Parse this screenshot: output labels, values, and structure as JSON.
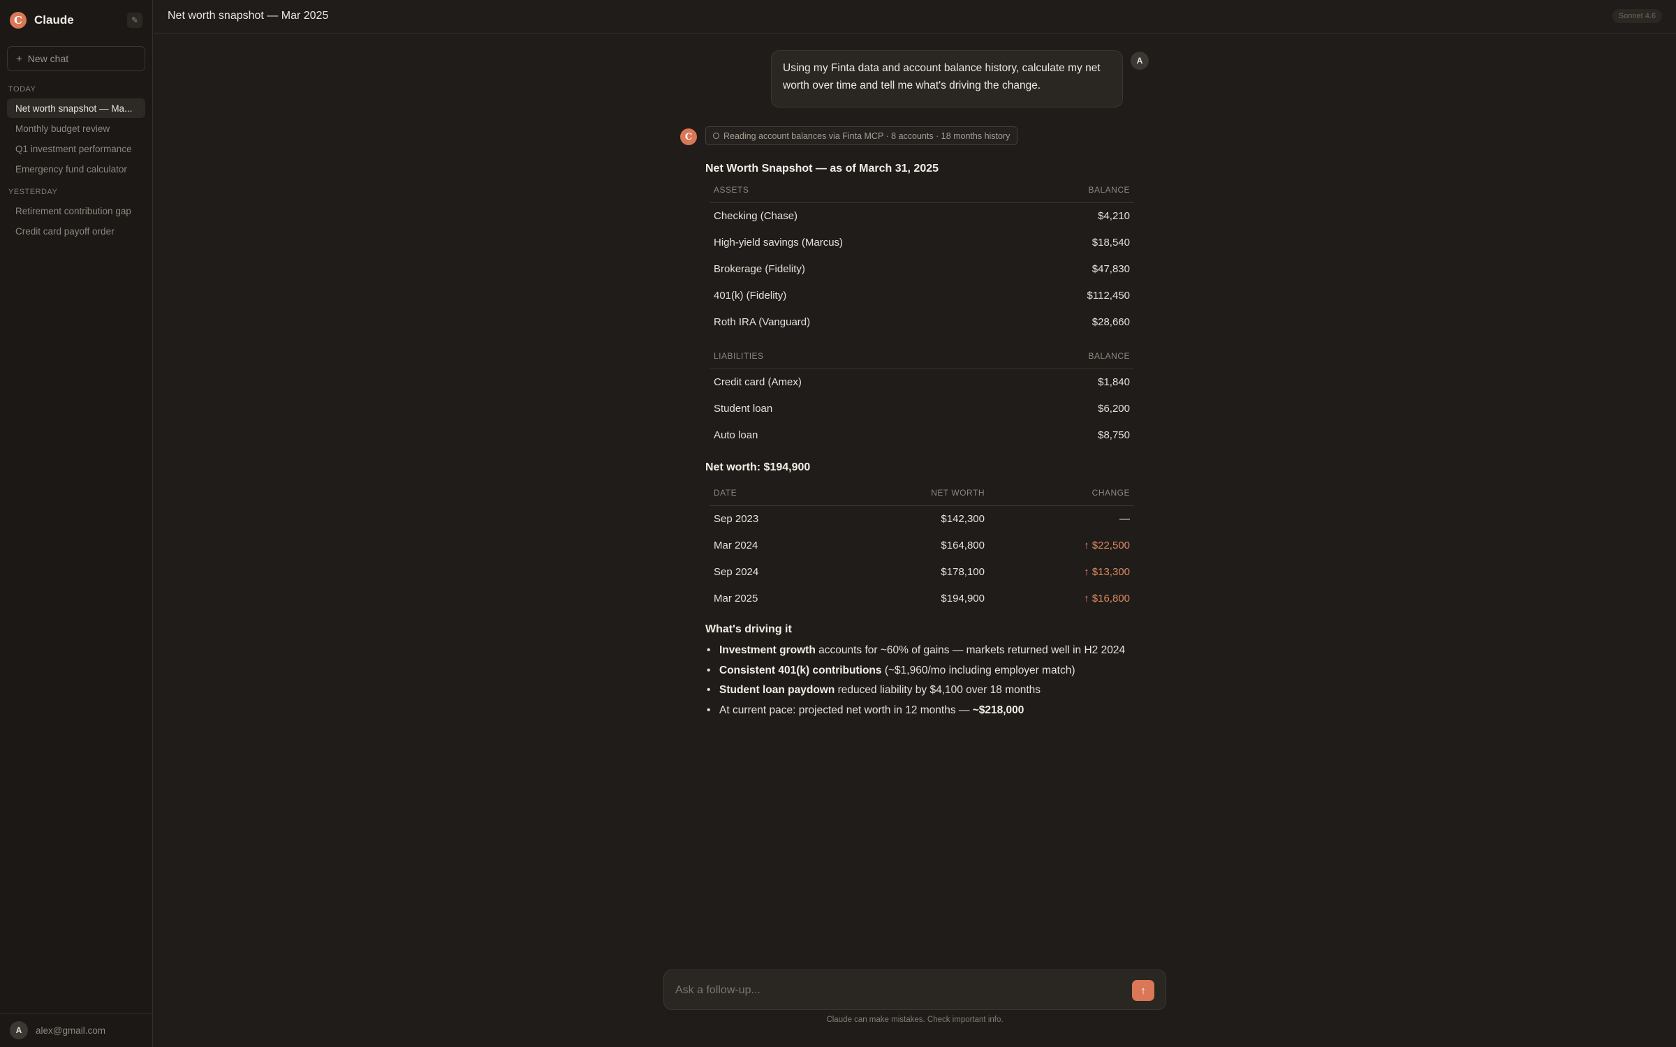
{
  "sidebar": {
    "brand": "Claude",
    "logo_letter": "C",
    "edit_icon": "✎",
    "new_chat_plus": "+",
    "new_chat_label": "New chat",
    "section_today": "TODAY",
    "section_yesterday": "YESTERDAY",
    "today_items": [
      {
        "label": "Net worth snapshot — Ma..."
      },
      {
        "label": "Monthly budget review"
      },
      {
        "label": "Q1 investment performance"
      },
      {
        "label": "Emergency fund calculator"
      }
    ],
    "yesterday_items": [
      {
        "label": "Retirement contribution gap"
      },
      {
        "label": "Credit card payoff order"
      }
    ],
    "user_initial": "A",
    "user_email": "alex@gmail.com"
  },
  "header": {
    "title": "Net worth snapshot — Mar 2025",
    "model": "Sonnet 4.6"
  },
  "user_message": {
    "avatar": "A",
    "text": "Using my Finta data and account balance history, calculate my net worth over time and tell me what's driving the change."
  },
  "assistant": {
    "icon_letter": "C",
    "tool_status": "Reading account balances via Finta MCP · 8 accounts · 18 months history",
    "snapshot_title": "Net Worth Snapshot — as of March 31, 2025",
    "assets_header": "ASSETS",
    "balance_header": "BALANCE",
    "assets": [
      {
        "name": "Checking (Chase)",
        "balance": "$4,210"
      },
      {
        "name": "High-yield savings (Marcus)",
        "balance": "$18,540"
      },
      {
        "name": "Brokerage (Fidelity)",
        "balance": "$47,830"
      },
      {
        "name": "401(k) (Fidelity)",
        "balance": "$112,450"
      },
      {
        "name": "Roth IRA (Vanguard)",
        "balance": "$28,660"
      }
    ],
    "liabilities_header": "LIABILITIES",
    "liabilities": [
      {
        "name": "Credit card (Amex)",
        "balance": "$1,840"
      },
      {
        "name": "Student loan",
        "balance": "$6,200"
      },
      {
        "name": "Auto loan",
        "balance": "$8,750"
      }
    ],
    "net_worth_line": "Net worth: $194,900",
    "history_headers": {
      "date": "DATE",
      "net_worth": "NET WORTH",
      "change": "CHANGE"
    },
    "history": [
      {
        "date": "Sep 2023",
        "net_worth": "$142,300",
        "change": "—"
      },
      {
        "date": "Mar 2024",
        "net_worth": "$164,800",
        "change": "↑ $22,500"
      },
      {
        "date": "Sep 2024",
        "net_worth": "$178,100",
        "change": "↑ $13,300"
      },
      {
        "date": "Mar 2025",
        "net_worth": "$194,900",
        "change": "↑ $16,800"
      }
    ],
    "driving_title": "What's driving it",
    "drivers": [
      {
        "bold": "Investment growth",
        "rest": " accounts for ~60% of gains — markets returned well in H2 2024"
      },
      {
        "bold": "Consistent 401(k) contributions",
        "rest": " (~$1,960/mo including employer match)"
      },
      {
        "bold": "Student loan paydown",
        "rest": " reduced liability by $4,100 over 18 months"
      }
    ],
    "projection_text": "At current pace: projected net worth in 12 months — ",
    "projection_value": "~$218,000"
  },
  "composer": {
    "placeholder": "Ask a follow-up...",
    "send_icon": "↑",
    "disclaimer": "Claude can make mistakes. Check important info."
  }
}
